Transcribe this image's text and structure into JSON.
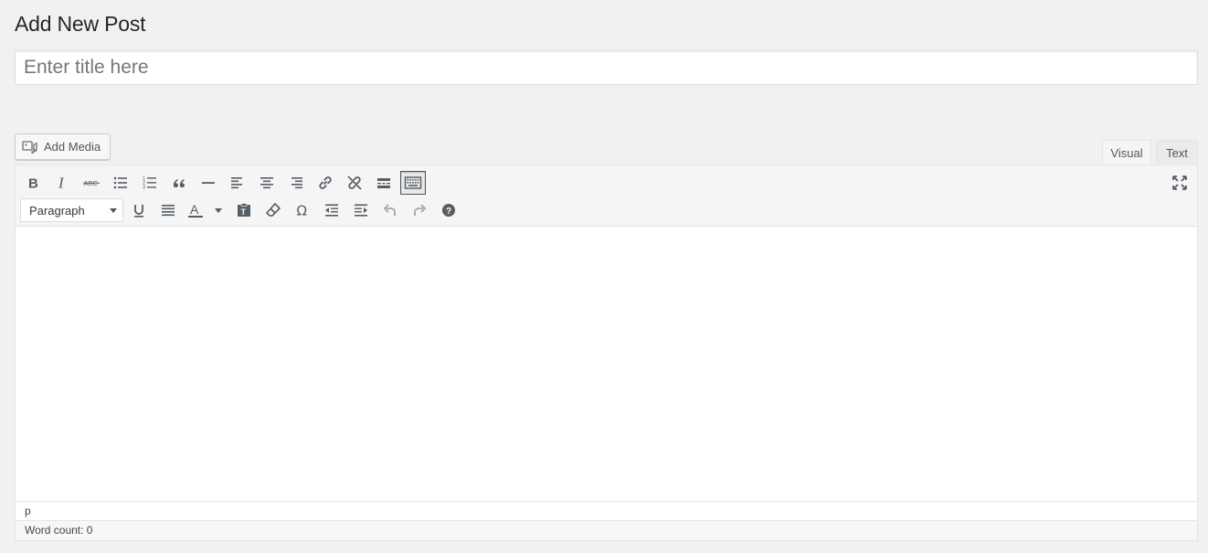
{
  "page": {
    "title": "Add New Post"
  },
  "title_field": {
    "placeholder": "Enter title here",
    "value": ""
  },
  "media": {
    "add_media_label": "Add Media"
  },
  "tabs": {
    "visual": "Visual",
    "text": "Text",
    "active": "Visual"
  },
  "toolbar": {
    "row1": [
      "bold-icon",
      "italic-icon",
      "strikethrough-icon",
      "bulleted-list-icon",
      "numbered-list-icon",
      "blockquote-icon",
      "horizontal-line-icon",
      "align-left-icon",
      "align-center-icon",
      "align-right-icon",
      "insert-link-icon",
      "remove-link-icon",
      "read-more-icon",
      "toolbar-toggle-icon"
    ],
    "row2": [
      "underline-icon",
      "justify-icon",
      "text-color-icon",
      "paste-as-text-icon",
      "clear-formatting-icon",
      "special-character-icon",
      "outdent-icon",
      "indent-icon",
      "undo-icon",
      "redo-icon",
      "help-icon"
    ],
    "format": {
      "selected": "Paragraph"
    },
    "fullscreen": "fullscreen-icon"
  },
  "editor": {
    "path": "p",
    "word_count": "Word count: 0"
  },
  "colors": {
    "background": "#f1f1f1",
    "icon": "#555d66",
    "disabled_icon": "#a0a5aa"
  }
}
